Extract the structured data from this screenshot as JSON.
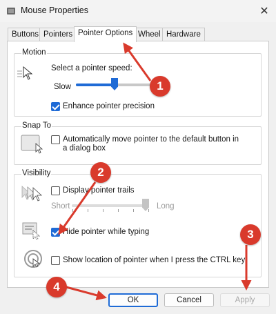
{
  "window": {
    "title": "Mouse Properties",
    "icon": "mouse-icon",
    "close_glyph": "✕"
  },
  "tabs": [
    {
      "label": "Buttons",
      "active": false
    },
    {
      "label": "Pointers",
      "active": false
    },
    {
      "label": "Pointer Options",
      "active": true
    },
    {
      "label": "Wheel",
      "active": false
    },
    {
      "label": "Hardware",
      "active": false
    }
  ],
  "motion": {
    "title": "Motion",
    "speed_label": "Select a pointer speed:",
    "slow_label": "Slow",
    "speed_level": 0.5,
    "enhance_label": "Enhance pointer precision",
    "enhance_checked": true
  },
  "snap_to": {
    "title": "Snap To",
    "label": "Automatically move pointer to the default button in a dialog box",
    "checked": false
  },
  "visibility": {
    "title": "Visibility",
    "trails_label": "Display pointer trails",
    "trails_checked": false,
    "trails_short": "Short",
    "trails_long": "Long",
    "trails_level": 1.0,
    "hide_label": "Hide pointer while typing",
    "hide_checked": true,
    "ctrl_label": "Show location of pointer when I press the CTRL key",
    "ctrl_checked": false
  },
  "buttons": {
    "ok": "OK",
    "cancel": "Cancel",
    "apply": "Apply"
  },
  "annotations": {
    "color": "#d93a2c",
    "markers": [
      "1",
      "2",
      "3",
      "4"
    ]
  }
}
